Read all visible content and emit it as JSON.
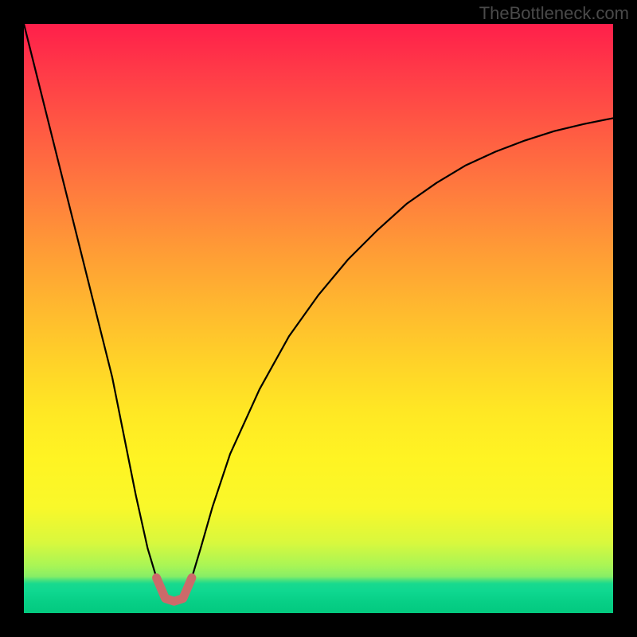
{
  "watermark": "TheBottleneck.com",
  "chart_data": {
    "type": "line",
    "title": "",
    "xlabel": "",
    "ylabel": "",
    "xlim": [
      0,
      100
    ],
    "ylim": [
      0,
      100
    ],
    "x": [
      0,
      3,
      6,
      9,
      12,
      15,
      17,
      19,
      21,
      22.5,
      24,
      25.5,
      27,
      28.5,
      30,
      32,
      35,
      40,
      45,
      50,
      55,
      60,
      65,
      70,
      75,
      80,
      85,
      90,
      95,
      100
    ],
    "y": [
      100,
      88,
      76,
      64,
      52,
      40,
      30,
      20,
      11,
      6,
      2.5,
      2,
      2.5,
      6,
      11,
      18,
      27,
      38,
      47,
      54,
      60,
      65,
      69.5,
      73,
      76,
      78.3,
      80.2,
      81.8,
      83,
      84
    ],
    "notch_region_x": [
      22,
      29
    ],
    "notch_region_y_threshold": 10,
    "background_gradient_stops": [
      {
        "pos": 0.0,
        "color": "#ff1f4a"
      },
      {
        "pos": 0.18,
        "color": "#ff5a43"
      },
      {
        "pos": 0.38,
        "color": "#ff9a36"
      },
      {
        "pos": 0.58,
        "color": "#ffd428"
      },
      {
        "pos": 0.74,
        "color": "#fff423"
      },
      {
        "pos": 0.88,
        "color": "#d9f83d"
      },
      {
        "pos": 1.0,
        "color": "#0fd890"
      }
    ],
    "curve_color": "#000000",
    "notch_highlight_color": "#cc6a6a"
  }
}
